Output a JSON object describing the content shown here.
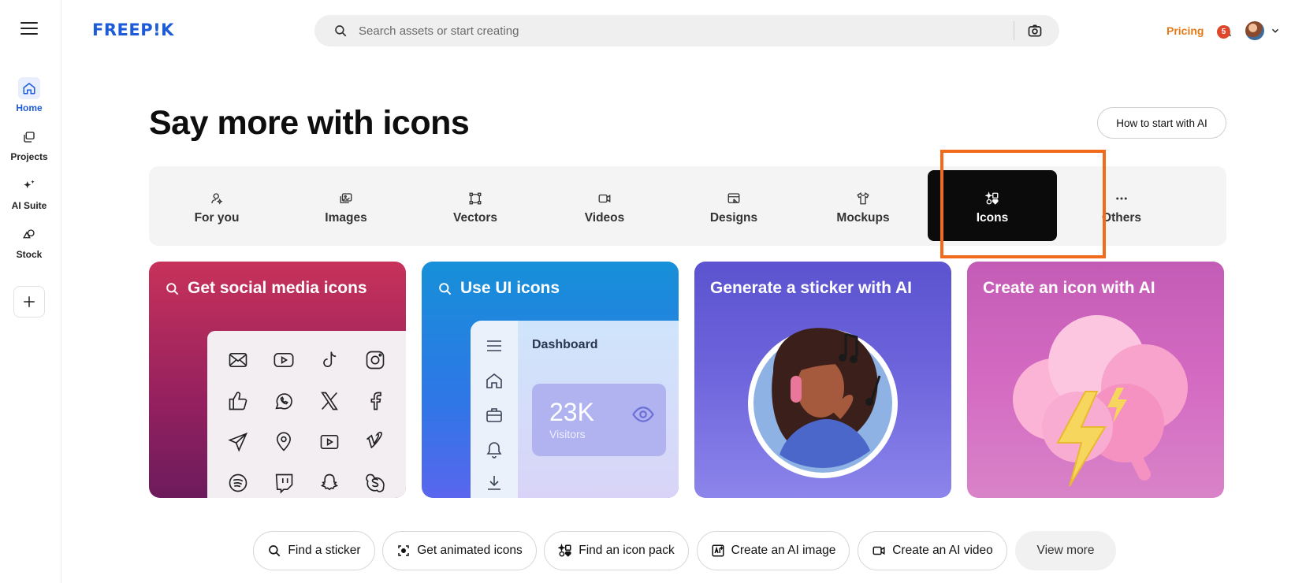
{
  "brand": {
    "logo": "FREEP!K",
    "accent": "#1d5bd8"
  },
  "rail": {
    "items": [
      {
        "label": "Home",
        "icon": "home-icon",
        "active": true
      },
      {
        "label": "Projects",
        "icon": "projects-icon"
      },
      {
        "label": "AI Suite",
        "icon": "sparkles-icon"
      },
      {
        "label": "Stock",
        "icon": "shapes-icon"
      }
    ],
    "add_icon": "plus-icon"
  },
  "header": {
    "search_placeholder": "Search assets or start creating",
    "pricing": "Pricing",
    "notification_count": "5"
  },
  "page": {
    "title": "Say more with icons",
    "how_to_button": "How to start with AI"
  },
  "categories": [
    {
      "label": "For you",
      "icon": "user-sparkle-icon"
    },
    {
      "label": "Images",
      "icon": "images-icon"
    },
    {
      "label": "Vectors",
      "icon": "vector-nodes-icon"
    },
    {
      "label": "Videos",
      "icon": "video-camera-icon"
    },
    {
      "label": "Designs",
      "icon": "design-icon"
    },
    {
      "label": "Mockups",
      "icon": "tshirt-icon"
    },
    {
      "label": "Icons",
      "icon": "icons-shapes-icon",
      "active": true
    },
    {
      "label": "Others",
      "icon": "more-dots-icon"
    }
  ],
  "cards": [
    {
      "title": "Get social media icons",
      "search": true
    },
    {
      "title": "Use UI icons",
      "search": true,
      "dashboard": "Dashboard",
      "stat_value": "23K",
      "stat_label": "Visitors"
    },
    {
      "title": "Generate a sticker with AI",
      "search": false
    },
    {
      "title": "Create an icon with AI",
      "search": false
    }
  ],
  "chips": [
    {
      "label": "Find a sticker",
      "icon": "search-icon"
    },
    {
      "label": "Get animated icons",
      "icon": "animated-icon"
    },
    {
      "label": "Find an icon pack",
      "icon": "icon-pack-icon"
    },
    {
      "label": "Create an AI image",
      "icon": "ai-image-icon"
    },
    {
      "label": "Create an AI video",
      "icon": "ai-video-icon"
    },
    {
      "label": "View more",
      "icon": ""
    }
  ],
  "colors": {
    "pricing": "#e37a16",
    "highlight": "#f26b1d",
    "active_tab": "#0b0b0b"
  }
}
